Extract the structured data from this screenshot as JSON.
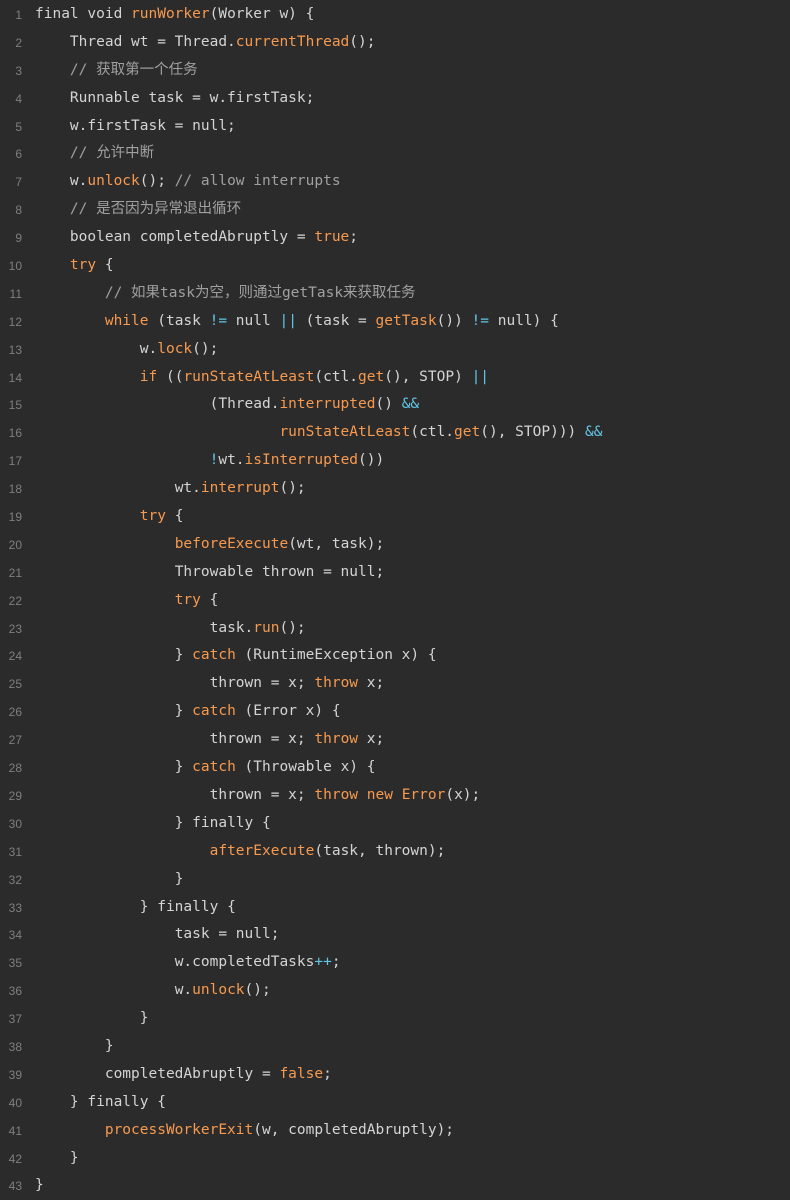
{
  "editor": {
    "indent_unit": "    ",
    "lines": [
      {
        "n": "1",
        "indent": 0,
        "tokens": [
          {
            "t": "final void ",
            "k": "pl"
          },
          {
            "t": "runWorker",
            "k": "fn"
          },
          {
            "t": "(Worker w) {",
            "k": "pl"
          }
        ]
      },
      {
        "n": "2",
        "indent": 1,
        "tokens": [
          {
            "t": "Thread wt = Thread.",
            "k": "pl"
          },
          {
            "t": "currentThread",
            "k": "fn"
          },
          {
            "t": "();",
            "k": "pl"
          }
        ]
      },
      {
        "n": "3",
        "indent": 1,
        "tokens": [
          {
            "t": "// 获取第一个任务",
            "k": "cm"
          }
        ]
      },
      {
        "n": "4",
        "indent": 1,
        "tokens": [
          {
            "t": "Runnable task = w.firstTask;",
            "k": "pl"
          }
        ]
      },
      {
        "n": "5",
        "indent": 1,
        "tokens": [
          {
            "t": "w.firstTask = null;",
            "k": "pl"
          }
        ]
      },
      {
        "n": "6",
        "indent": 1,
        "tokens": [
          {
            "t": "// 允许中断",
            "k": "cm"
          }
        ]
      },
      {
        "n": "7",
        "indent": 1,
        "tokens": [
          {
            "t": "w.",
            "k": "pl"
          },
          {
            "t": "unlock",
            "k": "fn"
          },
          {
            "t": "(); ",
            "k": "pl"
          },
          {
            "t": "// allow interrupts",
            "k": "cm"
          }
        ]
      },
      {
        "n": "8",
        "indent": 1,
        "tokens": [
          {
            "t": "// 是否因为异常退出循环",
            "k": "cm"
          }
        ]
      },
      {
        "n": "9",
        "indent": 1,
        "tokens": [
          {
            "t": "boolean completedAbruptly = ",
            "k": "pl"
          },
          {
            "t": "true",
            "k": "kw"
          },
          {
            "t": ";",
            "k": "pl"
          }
        ]
      },
      {
        "n": "10",
        "indent": 1,
        "tokens": [
          {
            "t": "try",
            "k": "kw"
          },
          {
            "t": " {",
            "k": "pl"
          }
        ]
      },
      {
        "n": "11",
        "indent": 2,
        "tokens": [
          {
            "t": "// 如果task为空，则通过getTask来获取任务",
            "k": "cm"
          }
        ]
      },
      {
        "n": "12",
        "indent": 2,
        "tokens": [
          {
            "t": "while",
            "k": "kw"
          },
          {
            "t": " (task ",
            "k": "pl"
          },
          {
            "t": "!=",
            "k": "op"
          },
          {
            "t": " null ",
            "k": "pl"
          },
          {
            "t": "||",
            "k": "op"
          },
          {
            "t": " (task = ",
            "k": "pl"
          },
          {
            "t": "getTask",
            "k": "fn"
          },
          {
            "t": "()) ",
            "k": "pl"
          },
          {
            "t": "!=",
            "k": "op"
          },
          {
            "t": " null) {",
            "k": "pl"
          }
        ]
      },
      {
        "n": "13",
        "indent": 3,
        "tokens": [
          {
            "t": "w.",
            "k": "pl"
          },
          {
            "t": "lock",
            "k": "fn"
          },
          {
            "t": "();",
            "k": "pl"
          }
        ]
      },
      {
        "n": "14",
        "indent": 3,
        "tokens": [
          {
            "t": "if",
            "k": "kw"
          },
          {
            "t": " ((",
            "k": "pl"
          },
          {
            "t": "runStateAtLeast",
            "k": "fn"
          },
          {
            "t": "(ctl.",
            "k": "pl"
          },
          {
            "t": "get",
            "k": "fn"
          },
          {
            "t": "(), STOP) ",
            "k": "pl"
          },
          {
            "t": "||",
            "k": "op"
          }
        ]
      },
      {
        "n": "15",
        "indent": 5,
        "tokens": [
          {
            "t": "(Thread.",
            "k": "pl"
          },
          {
            "t": "interrupted",
            "k": "fn"
          },
          {
            "t": "() ",
            "k": "pl"
          },
          {
            "t": "&&",
            "k": "op"
          }
        ]
      },
      {
        "n": "16",
        "indent": 7,
        "tokens": [
          {
            "t": "runStateAtLeast",
            "k": "fn"
          },
          {
            "t": "(ctl.",
            "k": "pl"
          },
          {
            "t": "get",
            "k": "fn"
          },
          {
            "t": "(), STOP))) ",
            "k": "pl"
          },
          {
            "t": "&&",
            "k": "op"
          }
        ]
      },
      {
        "n": "17",
        "indent": 5,
        "tokens": [
          {
            "t": "!",
            "k": "op"
          },
          {
            "t": "wt.",
            "k": "pl"
          },
          {
            "t": "isInterrupted",
            "k": "fn"
          },
          {
            "t": "())",
            "k": "pl"
          }
        ]
      },
      {
        "n": "18",
        "indent": 4,
        "tokens": [
          {
            "t": "wt.",
            "k": "pl"
          },
          {
            "t": "interrupt",
            "k": "fn"
          },
          {
            "t": "();",
            "k": "pl"
          }
        ]
      },
      {
        "n": "19",
        "indent": 3,
        "tokens": [
          {
            "t": "try",
            "k": "kw"
          },
          {
            "t": " {",
            "k": "pl"
          }
        ]
      },
      {
        "n": "20",
        "indent": 4,
        "tokens": [
          {
            "t": "beforeExecute",
            "k": "fn"
          },
          {
            "t": "(wt, task);",
            "k": "pl"
          }
        ]
      },
      {
        "n": "21",
        "indent": 4,
        "tokens": [
          {
            "t": "Throwable thrown = null;",
            "k": "pl"
          }
        ]
      },
      {
        "n": "22",
        "indent": 4,
        "tokens": [
          {
            "t": "try",
            "k": "kw"
          },
          {
            "t": " {",
            "k": "pl"
          }
        ]
      },
      {
        "n": "23",
        "indent": 5,
        "tokens": [
          {
            "t": "task.",
            "k": "pl"
          },
          {
            "t": "run",
            "k": "fn"
          },
          {
            "t": "();",
            "k": "pl"
          }
        ]
      },
      {
        "n": "24",
        "indent": 4,
        "tokens": [
          {
            "t": "} ",
            "k": "pl"
          },
          {
            "t": "catch",
            "k": "kw"
          },
          {
            "t": " (RuntimeException x) {",
            "k": "pl"
          }
        ]
      },
      {
        "n": "25",
        "indent": 5,
        "tokens": [
          {
            "t": "thrown = x; ",
            "k": "pl"
          },
          {
            "t": "throw",
            "k": "kw"
          },
          {
            "t": " x;",
            "k": "pl"
          }
        ]
      },
      {
        "n": "26",
        "indent": 4,
        "tokens": [
          {
            "t": "} ",
            "k": "pl"
          },
          {
            "t": "catch",
            "k": "kw"
          },
          {
            "t": " (Error x) {",
            "k": "pl"
          }
        ]
      },
      {
        "n": "27",
        "indent": 5,
        "tokens": [
          {
            "t": "thrown = x; ",
            "k": "pl"
          },
          {
            "t": "throw",
            "k": "kw"
          },
          {
            "t": " x;",
            "k": "pl"
          }
        ]
      },
      {
        "n": "28",
        "indent": 4,
        "tokens": [
          {
            "t": "} ",
            "k": "pl"
          },
          {
            "t": "catch",
            "k": "kw"
          },
          {
            "t": " (Throwable x) {",
            "k": "pl"
          }
        ]
      },
      {
        "n": "29",
        "indent": 5,
        "tokens": [
          {
            "t": "thrown = x; ",
            "k": "pl"
          },
          {
            "t": "throw new ",
            "k": "kw"
          },
          {
            "t": "Error",
            "k": "fn"
          },
          {
            "t": "(x);",
            "k": "pl"
          }
        ]
      },
      {
        "n": "30",
        "indent": 4,
        "tokens": [
          {
            "t": "} finally {",
            "k": "pl"
          }
        ]
      },
      {
        "n": "31",
        "indent": 5,
        "tokens": [
          {
            "t": "afterExecute",
            "k": "fn"
          },
          {
            "t": "(task, thrown);",
            "k": "pl"
          }
        ]
      },
      {
        "n": "32",
        "indent": 4,
        "tokens": [
          {
            "t": "}",
            "k": "pl"
          }
        ]
      },
      {
        "n": "33",
        "indent": 3,
        "tokens": [
          {
            "t": "} finally {",
            "k": "pl"
          }
        ]
      },
      {
        "n": "34",
        "indent": 4,
        "tokens": [
          {
            "t": "task = null;",
            "k": "pl"
          }
        ]
      },
      {
        "n": "35",
        "indent": 4,
        "tokens": [
          {
            "t": "w.completedTasks",
            "k": "pl"
          },
          {
            "t": "++",
            "k": "op"
          },
          {
            "t": ";",
            "k": "pl"
          }
        ]
      },
      {
        "n": "36",
        "indent": 4,
        "tokens": [
          {
            "t": "w.",
            "k": "pl"
          },
          {
            "t": "unlock",
            "k": "fn"
          },
          {
            "t": "();",
            "k": "pl"
          }
        ]
      },
      {
        "n": "37",
        "indent": 3,
        "tokens": [
          {
            "t": "}",
            "k": "pl"
          }
        ]
      },
      {
        "n": "38",
        "indent": 2,
        "tokens": [
          {
            "t": "}",
            "k": "pl"
          }
        ]
      },
      {
        "n": "39",
        "indent": 2,
        "tokens": [
          {
            "t": "completedAbruptly = ",
            "k": "pl"
          },
          {
            "t": "false",
            "k": "kw"
          },
          {
            "t": ";",
            "k": "pl"
          }
        ]
      },
      {
        "n": "40",
        "indent": 1,
        "tokens": [
          {
            "t": "} finally {",
            "k": "pl"
          }
        ]
      },
      {
        "n": "41",
        "indent": 2,
        "tokens": [
          {
            "t": "processWorkerExit",
            "k": "fn"
          },
          {
            "t": "(w, completedAbruptly);",
            "k": "pl"
          }
        ]
      },
      {
        "n": "42",
        "indent": 1,
        "tokens": [
          {
            "t": "}",
            "k": "pl"
          }
        ]
      },
      {
        "n": "43",
        "indent": 0,
        "tokens": [
          {
            "t": "}",
            "k": "pl"
          }
        ]
      }
    ],
    "colors": {
      "background": "#2b2b2b",
      "line_number": "#7f7f7f",
      "comment": "#a0a0a0",
      "function": "#f79a4f",
      "keyword": "#f79a4f",
      "operator": "#62c5e6",
      "plain": "#d4d4d4"
    }
  }
}
